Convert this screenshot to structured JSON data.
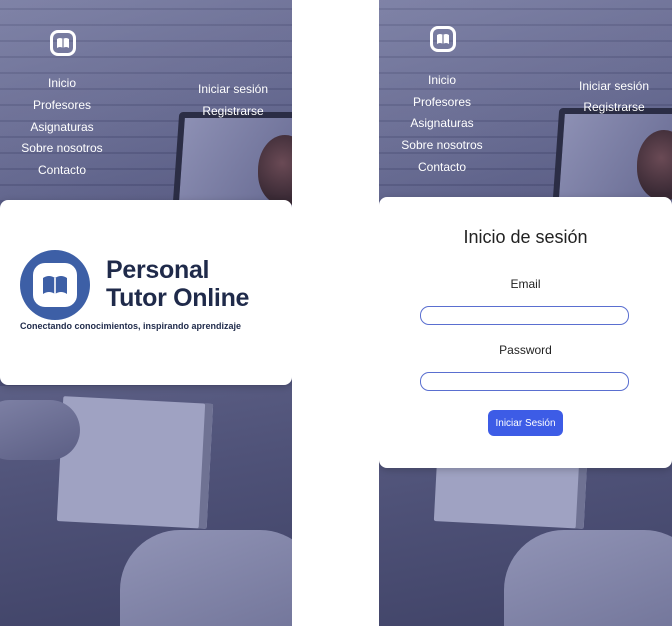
{
  "nav": {
    "logo_icon": "book-logo-icon",
    "links": [
      "Inicio",
      "Profesores",
      "Asignaturas",
      "Sobre nosotros",
      "Contacto"
    ],
    "auth_links": [
      "Iniciar sesión",
      "Registrarse"
    ]
  },
  "brand": {
    "name": "Personal Tutor Online",
    "tagline": "Conectando conocimientos, inspirando aprendizaje",
    "color": "#3d5fa6"
  },
  "login_form": {
    "title": "Inicio de sesión",
    "email_label": "Email",
    "email_value": "",
    "password_label": "Password",
    "password_value": "",
    "submit_label": "Iniciar Sesión",
    "accent_color": "#3d5ce6"
  }
}
